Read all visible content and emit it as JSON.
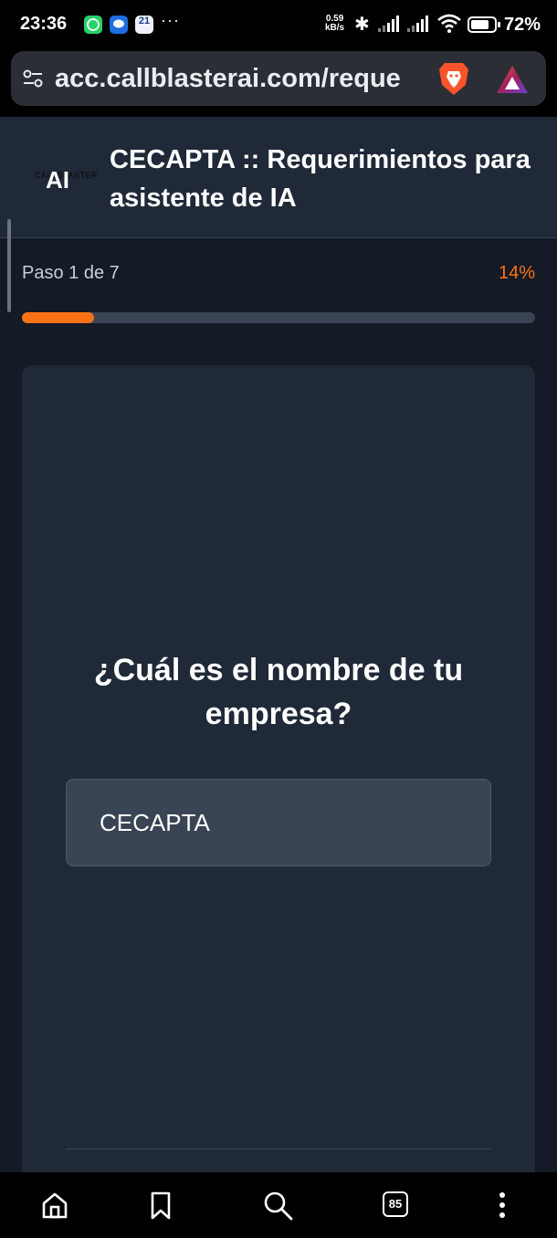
{
  "status_bar": {
    "time": "23:36",
    "calendar_day": "21",
    "more_indicator": "···",
    "net_speed_value": "0.59",
    "net_speed_unit": "kB/s",
    "battery_percent": "72%"
  },
  "browser": {
    "url": "acc.callblasterai.com/reque",
    "tabs_count": "85"
  },
  "header": {
    "logo_text": "AI",
    "logo_subtext": "CALLBLASTER",
    "title": "CECAPTA :: Requerimientos para asistente de IA"
  },
  "progress": {
    "step_label": "Paso 1 de 7",
    "percent_label": "14%",
    "fraction": 0.14
  },
  "form": {
    "question": "¿Cuál es el nombre de tu empresa?",
    "answer_value": "CECAPTA"
  },
  "colors": {
    "accent": "#f97316",
    "header_bg": "#1f2938",
    "page_bg": "#141a26",
    "input_bg": "#394454"
  },
  "icons": {
    "status": [
      "whatsapp-icon",
      "messages-icon",
      "calendar-icon",
      "bluetooth-icon",
      "signal-icon",
      "wifi-icon",
      "battery-icon"
    ],
    "browser": [
      "site-settings-icon",
      "brave-shields-icon",
      "brave-rewards-icon"
    ],
    "nav": [
      "home-icon",
      "bookmark-icon",
      "search-icon",
      "tabs-icon",
      "menu-icon"
    ]
  }
}
